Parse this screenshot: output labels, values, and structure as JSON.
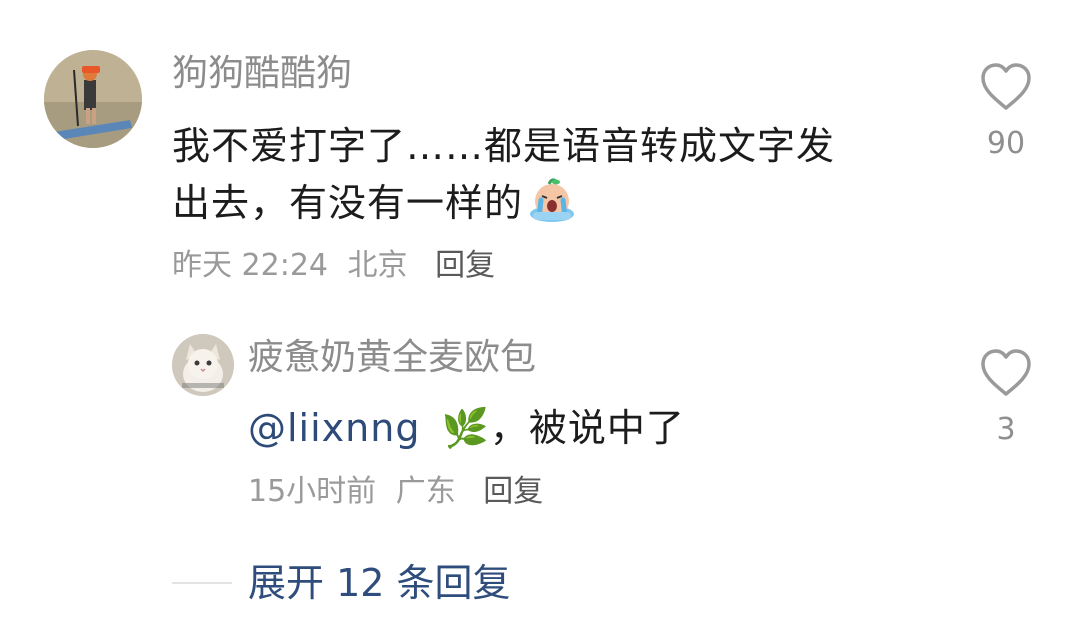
{
  "comment": {
    "username": "狗狗酷酷狗",
    "text_line1": "我不爱打字了……都是语音转成文字发",
    "text_line2": "出去，有没有一样的",
    "emoji": "crying-face-emoji",
    "time": "昨天 22:24",
    "location": "北京",
    "reply_label": "回复",
    "like_count": "90",
    "like_icon": "heart-outline-icon"
  },
  "reply": {
    "username": "疲惫奶黄全麦欧包",
    "mention": "@liixnng",
    "mention_emoji": "🌿",
    "text_rest": "，被说中了",
    "time": "15小时前",
    "location": "广东",
    "reply_label": "回复",
    "like_count": "3",
    "like_icon": "heart-outline-icon"
  },
  "expand": {
    "label": "展开 12 条回复"
  },
  "colors": {
    "username": "#8c8c8c",
    "text": "#1c1c1c",
    "meta": "#9a9a9a",
    "link": "#2f4d7c",
    "heart": "#9a9a9a"
  }
}
